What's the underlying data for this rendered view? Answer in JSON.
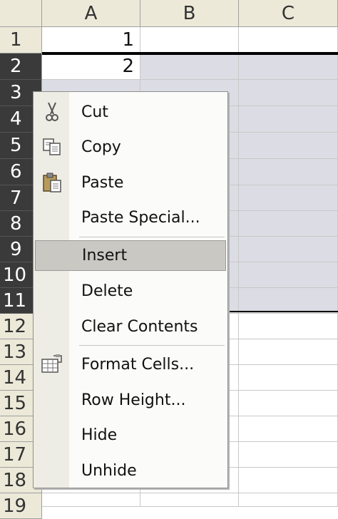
{
  "spreadsheet": {
    "columns": [
      "A",
      "B",
      "C"
    ],
    "rows": [
      "1",
      "2",
      "3",
      "4",
      "5",
      "6",
      "7",
      "8",
      "9",
      "10",
      "11",
      "12",
      "13",
      "14",
      "15",
      "16",
      "17",
      "18",
      "19"
    ],
    "cells": {
      "A1": "1",
      "A2": "2"
    },
    "selected_rows": [
      "2",
      "3",
      "4",
      "5",
      "6",
      "7",
      "8",
      "9",
      "10",
      "11"
    ]
  },
  "context_menu": {
    "items": [
      {
        "label": "Cut",
        "icon": "scissors-icon"
      },
      {
        "label": "Copy",
        "icon": "copy-icon"
      },
      {
        "label": "Paste",
        "icon": "paste-icon"
      },
      {
        "label": "Paste Special...",
        "icon": ""
      },
      {
        "label": "Insert",
        "icon": "",
        "highlighted": true
      },
      {
        "label": "Delete",
        "icon": ""
      },
      {
        "label": "Clear Contents",
        "icon": ""
      },
      {
        "label": "Format Cells...",
        "icon": "format-cells-icon"
      },
      {
        "label": "Row Height...",
        "icon": ""
      },
      {
        "label": "Hide",
        "icon": ""
      },
      {
        "label": "Unhide",
        "icon": ""
      }
    ]
  },
  "colors": {
    "header_bg": "#ece9d8",
    "selected_header_bg": "#3a3a3a",
    "selection_fill": "#dcdce4",
    "menu_highlight": "#c9c8c2"
  }
}
